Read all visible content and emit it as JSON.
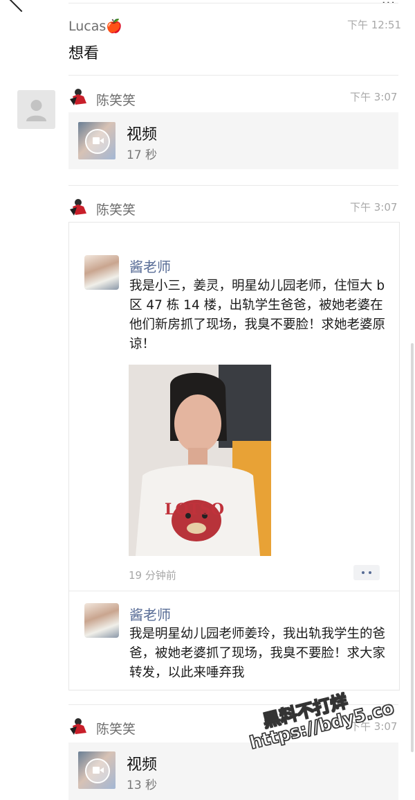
{
  "messages": [
    {
      "sender": "Lucas🍎",
      "time": "下午 12:51",
      "text": "想看"
    },
    {
      "sender": "陈笑笑",
      "time": "下午 3:07",
      "video_title": "视频",
      "video_duration": "17 秒"
    },
    {
      "sender": "陈笑笑",
      "time": "下午 3:07"
    },
    {
      "sender": "陈笑笑",
      "time": "下午 3:07",
      "video_title": "视频",
      "video_duration": "13 秒"
    }
  ],
  "moments": [
    {
      "name": "酱老师",
      "text": "我是小三，姜灵，明星幼儿园老师，住恒大 b 区 47 栋 14 楼，出轨学生爸爸，被她老婆在他们新房抓了现场，我臭不要脸！求她老婆原谅！",
      "time": "19 分钟前",
      "photo_text": "LOTSO"
    },
    {
      "name": "酱老师",
      "text": "我是明星幼儿园老师姜玲，我出轨我学生的爸爸，被她老婆抓了现场，我臭不要脸！求大家转发，以此来唾弃我"
    }
  ],
  "watermark": {
    "line1": "黑料不打烊",
    "line2": "https://bdy5.co"
  }
}
